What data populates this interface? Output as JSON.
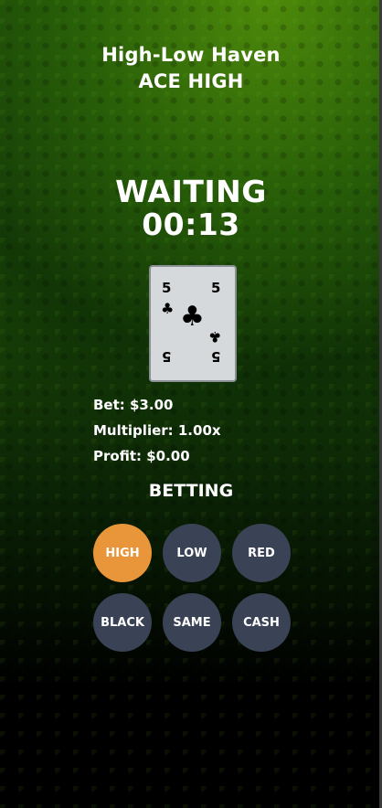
{
  "header": {
    "game_title": "High-Low Haven",
    "rule": "ACE HIGH"
  },
  "status": {
    "state": "WAITING",
    "timer": "00:13"
  },
  "card": {
    "rank": "5",
    "suit_symbol": "♣",
    "suit": "clubs"
  },
  "stats": {
    "bet": "Bet: $3.00",
    "multiplier": "Multiplier: 1.00x",
    "profit": "Profit: $0.00"
  },
  "betting": {
    "label": "BETTING",
    "buttons": [
      {
        "label": "HIGH",
        "active": true
      },
      {
        "label": "LOW",
        "active": false
      },
      {
        "label": "RED",
        "active": false
      },
      {
        "label": "BLACK",
        "active": false
      },
      {
        "label": "SAME",
        "active": false
      },
      {
        "label": "CASH",
        "active": false
      }
    ]
  },
  "colors": {
    "active_button": "#e9963a",
    "idle_button": "#3a4256",
    "card_face": "#d6d9dc"
  }
}
